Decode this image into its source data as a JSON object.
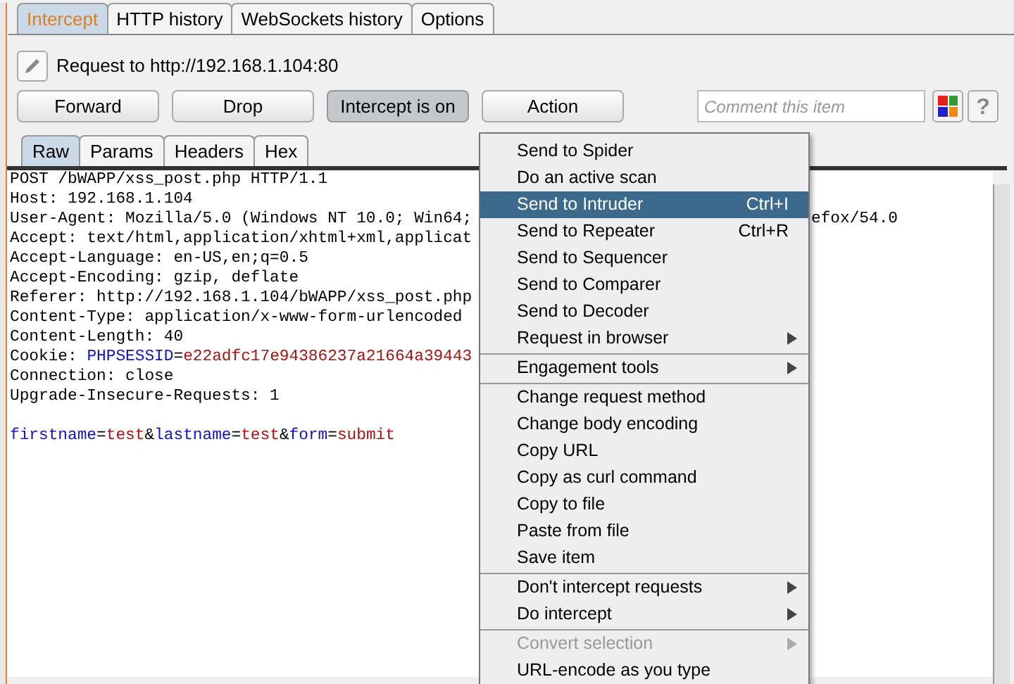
{
  "tabs": [
    {
      "label": "Intercept",
      "selected": true
    },
    {
      "label": "HTTP history",
      "selected": false
    },
    {
      "label": "WebSockets history",
      "selected": false
    },
    {
      "label": "Options",
      "selected": false
    }
  ],
  "request_label": "Request to http://192.168.1.104:80",
  "buttons": [
    {
      "label": "Forward",
      "pressed": false
    },
    {
      "label": "Drop",
      "pressed": false
    },
    {
      "label": "Intercept is on",
      "pressed": true
    },
    {
      "label": "Action",
      "pressed": false
    }
  ],
  "comment": {
    "placeholder": "Comment this item"
  },
  "help": "?",
  "editor_tabs": [
    {
      "label": "Raw",
      "selected": true
    },
    {
      "label": "Params",
      "selected": false
    },
    {
      "label": "Headers",
      "selected": false
    },
    {
      "label": "Hex",
      "selected": false
    }
  ],
  "editor_lines": [
    {
      "kind": "header",
      "segments": [
        {
          "kind": "plain",
          "text": "POST /bWAPP/xss_post.php HTTP/1.1"
        }
      ]
    },
    {
      "kind": "header",
      "segments": [
        {
          "kind": "plain",
          "text": "Host: 192.168.1.104"
        }
      ]
    },
    {
      "kind": "header",
      "segments": [
        {
          "kind": "plain",
          "text": "User-Agent: Mozilla/5.0 (Windows NT 10.0; Win64;"
        }
      ],
      "tail": "efox/54.0"
    },
    {
      "kind": "header",
      "segments": [
        {
          "kind": "plain",
          "text": "Accept: text/html,application/xhtml+xml,applicat"
        }
      ]
    },
    {
      "kind": "header",
      "segments": [
        {
          "kind": "plain",
          "text": "Accept-Language: en-US,en;q=0.5"
        }
      ]
    },
    {
      "kind": "header",
      "segments": [
        {
          "kind": "plain",
          "text": "Accept-Encoding: gzip, deflate"
        }
      ]
    },
    {
      "kind": "header",
      "segments": [
        {
          "kind": "plain",
          "text": "Referer: http://192.168.1.104/bWAPP/xss_post.php"
        }
      ]
    },
    {
      "kind": "header",
      "segments": [
        {
          "kind": "plain",
          "text": "Content-Type: application/x-www-form-urlencoded"
        }
      ]
    },
    {
      "kind": "header",
      "segments": [
        {
          "kind": "plain",
          "text": "Content-Length: 40"
        }
      ]
    },
    {
      "kind": "header",
      "segments": [
        {
          "kind": "plain",
          "text": "Cookie: "
        },
        {
          "kind": "name",
          "text": "PHPSESSID"
        },
        {
          "kind": "plain",
          "text": "="
        },
        {
          "kind": "value",
          "text": "e22adfc17e94386237a21664a39443"
        }
      ]
    },
    {
      "kind": "header",
      "segments": [
        {
          "kind": "plain",
          "text": "Connection: close"
        }
      ]
    },
    {
      "kind": "header",
      "segments": [
        {
          "kind": "plain",
          "text": "Upgrade-Insecure-Requests: 1"
        }
      ]
    },
    {
      "kind": "body",
      "segments": [
        {
          "kind": "name",
          "text": "firstname"
        },
        {
          "kind": "plain",
          "text": "="
        },
        {
          "kind": "value",
          "text": "test"
        },
        {
          "kind": "plain",
          "text": "&"
        },
        {
          "kind": "name",
          "text": "lastname"
        },
        {
          "kind": "plain",
          "text": "="
        },
        {
          "kind": "value",
          "text": "test"
        },
        {
          "kind": "plain",
          "text": "&"
        },
        {
          "kind": "name",
          "text": "form"
        },
        {
          "kind": "plain",
          "text": "="
        },
        {
          "kind": "value",
          "text": "submit"
        }
      ]
    }
  ],
  "menu_groups": [
    [
      {
        "label": "Send to Spider",
        "selected": false,
        "disabled": false,
        "submenu": false
      },
      {
        "label": "Do an active scan",
        "selected": false,
        "disabled": false,
        "submenu": false
      },
      {
        "label": "Send to Intruder",
        "shortcut": "Ctrl+I",
        "selected": true,
        "disabled": false,
        "submenu": false
      },
      {
        "label": "Send to Repeater",
        "shortcut": "Ctrl+R",
        "selected": false,
        "disabled": false,
        "submenu": false
      },
      {
        "label": "Send to Sequencer",
        "selected": false,
        "disabled": false,
        "submenu": false
      },
      {
        "label": "Send to Comparer",
        "selected": false,
        "disabled": false,
        "submenu": false
      },
      {
        "label": "Send to Decoder",
        "selected": false,
        "disabled": false,
        "submenu": false
      },
      {
        "label": "Request in browser",
        "selected": false,
        "disabled": false,
        "submenu": true
      }
    ],
    [
      {
        "label": "Engagement tools",
        "selected": false,
        "disabled": false,
        "submenu": true
      }
    ],
    [
      {
        "label": "Change request method",
        "selected": false,
        "disabled": false,
        "submenu": false
      },
      {
        "label": "Change body encoding",
        "selected": false,
        "disabled": false,
        "submenu": false
      },
      {
        "label": "Copy URL",
        "selected": false,
        "disabled": false,
        "submenu": false
      },
      {
        "label": "Copy as curl command",
        "selected": false,
        "disabled": false,
        "submenu": false
      },
      {
        "label": "Copy to file",
        "selected": false,
        "disabled": false,
        "submenu": false
      },
      {
        "label": "Paste from file",
        "selected": false,
        "disabled": false,
        "submenu": false
      },
      {
        "label": "Save item",
        "selected": false,
        "disabled": false,
        "submenu": false
      }
    ],
    [
      {
        "label": "Don't intercept requests",
        "selected": false,
        "disabled": false,
        "submenu": true
      },
      {
        "label": "Do intercept",
        "selected": false,
        "disabled": false,
        "submenu": true
      }
    ],
    [
      {
        "label": "Convert selection",
        "selected": false,
        "disabled": true,
        "submenu": true
      },
      {
        "label": "URL-encode as you type",
        "selected": false,
        "disabled": false,
        "submenu": false
      }
    ]
  ]
}
